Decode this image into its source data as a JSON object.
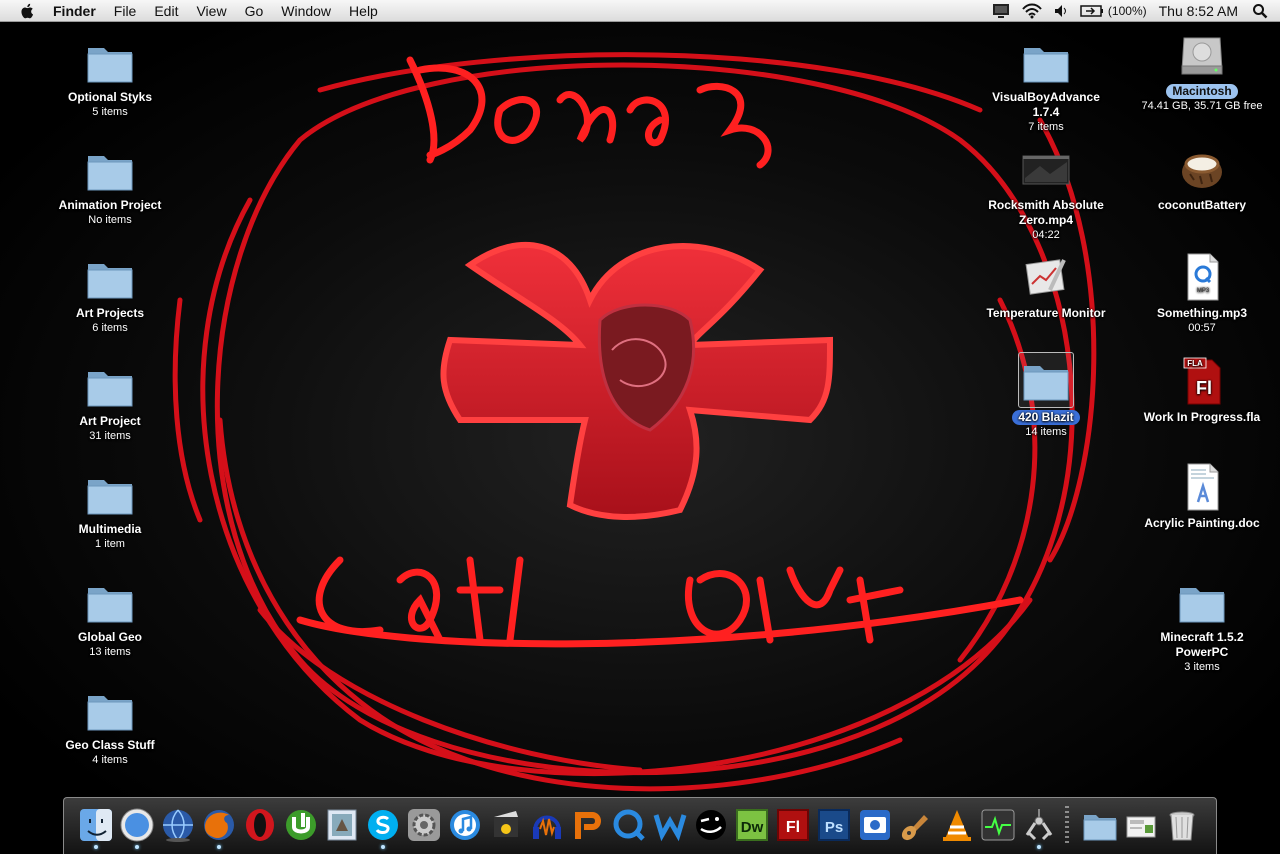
{
  "menubar": {
    "app_name": "Finder",
    "menus": [
      "File",
      "Edit",
      "View",
      "Go",
      "Window",
      "Help"
    ],
    "battery_text": "(100%)",
    "clock": "Thu 8:52 AM",
    "status_icons": [
      "display-icon",
      "wifi-icon",
      "volume-icon",
      "battery-icon",
      "spotlight-icon"
    ]
  },
  "wallpaper": {
    "colors": {
      "background": "#000000",
      "scribble": "#e0101a",
      "cross": "#d8202a"
    }
  },
  "desktop": {
    "left_column": [
      {
        "name": "Optional Styks",
        "info": "5 items"
      },
      {
        "name": "Animation Project",
        "info": "No items"
      },
      {
        "name": "Art Projects",
        "info": "6 items"
      },
      {
        "name": "Art Project",
        "info": "31 items"
      },
      {
        "name": "Multimedia",
        "info": "1 item"
      },
      {
        "name": "Global Geo",
        "info": "13 items"
      },
      {
        "name": "Geo Class Stuff",
        "info": "4 items"
      }
    ],
    "middle_column": [
      {
        "name_line1": "VisualBoyAdvance",
        "name_line2": "1.7.4",
        "info": "7 items"
      },
      {
        "name_line1": "Rocksmith Absolute",
        "name_line2": "Zero.mp4",
        "info": "04:22"
      },
      {
        "name": "Temperature Monitor"
      },
      {
        "name": "420 Blazit",
        "info": "14 items",
        "selected": true
      }
    ],
    "right_column": [
      {
        "name": "Macintosh",
        "info": "74.41 GB, 35.71 GB free",
        "selected": true
      },
      {
        "name": "coconutBattery"
      },
      {
        "name": "Something.mp3",
        "info": "00:57"
      },
      {
        "name": "Work In Progress.fla",
        "badge": "FLA",
        "glyph": "Fl"
      },
      {
        "name": "Acrylic Painting.doc"
      },
      {
        "name_line1": "Minecraft 1.5.2",
        "name_line2": "PowerPC",
        "info": "3 items"
      }
    ]
  },
  "dock": {
    "items": [
      "finder-icon",
      "safari-icon",
      "network-globe-icon",
      "firefox-icon",
      "opera-icon",
      "utorrent-icon",
      "preview-icon",
      "skype-icon",
      "system-preferences-icon",
      "itunes-icon",
      "imovie-icon",
      "audacity-icon",
      "p-app-icon",
      "quicktime-icon",
      "w-app-icon",
      "face-app-icon",
      "dreamweaver-icon",
      "flash-icon",
      "photoshop-icon",
      "photo-booth-icon",
      "garageband-icon",
      "vlc-icon",
      "activity-monitor-icon",
      "grab-icon",
      "applications-folder-icon",
      "downloads-icon",
      "trash-icon"
    ],
    "glyphs": {
      "dw": "Dw",
      "fl": "Fl",
      "ps": "Ps",
      "mp3": "MP3"
    }
  }
}
